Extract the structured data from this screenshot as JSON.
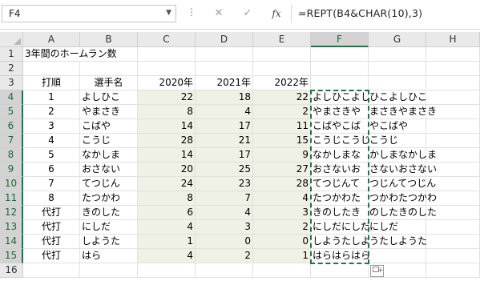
{
  "formula_bar": {
    "name_box": "F4",
    "formula": "=REPT(B4&CHAR(10),3)",
    "cancel_icon": "✕",
    "enter_icon": "✓",
    "fx_label": "fx",
    "more_icon": "⋮"
  },
  "columns": [
    "A",
    "B",
    "C",
    "D",
    "E",
    "F",
    "G",
    "H"
  ],
  "rows": [
    "1",
    "2",
    "3",
    "4",
    "5",
    "6",
    "7",
    "8",
    "9",
    "10",
    "11",
    "12",
    "13",
    "14",
    "15",
    "16"
  ],
  "title": "3年間のホームラン数",
  "headers": {
    "order": "打順",
    "player": "選手名",
    "y2020": "2020年",
    "y2021": "2021年",
    "y2022": "2022年"
  },
  "table": [
    {
      "order": "1",
      "player": "よしひこ",
      "y2020": "22",
      "y2021": "18",
      "y2022": "22",
      "f_text": "よしひこよし",
      "over_text": "ひこよしひこ"
    },
    {
      "order": "2",
      "player": "やまさき",
      "y2020": "8",
      "y2021": "4",
      "y2022": "2",
      "f_text": "やまさきや",
      "over_text": "まさきやまさき"
    },
    {
      "order": "3",
      "player": "こばや",
      "y2020": "14",
      "y2021": "17",
      "y2022": "11",
      "f_text": "こばやこば",
      "over_text": "やこばや"
    },
    {
      "order": "4",
      "player": "こうじ",
      "y2020": "28",
      "y2021": "21",
      "y2022": "15",
      "f_text": "こうじこうじ",
      "over_text": "こうじ"
    },
    {
      "order": "5",
      "player": "なかしま",
      "y2020": "14",
      "y2021": "17",
      "y2022": "9",
      "f_text": "なかしまな",
      "over_text": "かしまなかしま"
    },
    {
      "order": "6",
      "player": "おさない",
      "y2020": "20",
      "y2021": "25",
      "y2022": "27",
      "f_text": "おさないお",
      "over_text": "さないおさない"
    },
    {
      "order": "7",
      "player": "てつじん",
      "y2020": "24",
      "y2021": "23",
      "y2022": "28",
      "f_text": "てつじんて",
      "over_text": "つじんてつじん"
    },
    {
      "order": "8",
      "player": "たつかわ",
      "y2020": "8",
      "y2021": "7",
      "y2022": "4",
      "f_text": "たつかわた",
      "over_text": "つかわたつかわ"
    },
    {
      "order": "代打",
      "player": "きのした",
      "y2020": "6",
      "y2021": "4",
      "y2022": "3",
      "f_text": "きのしたき",
      "over_text": "のしたきのした"
    },
    {
      "order": "代打",
      "player": "にしだ",
      "y2020": "4",
      "y2021": "3",
      "y2022": "2",
      "f_text": "にしだにしだ",
      "over_text": "にしだ"
    },
    {
      "order": "代打",
      "player": "しようた",
      "y2020": "1",
      "y2021": "0",
      "y2022": "0",
      "f_text": "しようたしよ",
      "over_text": "うたしようた"
    },
    {
      "order": "代打",
      "player": "はら",
      "y2020": "4",
      "y2021": "2",
      "y2022": "1",
      "f_text": "はらはらはら",
      "over_text": ""
    }
  ],
  "colors": {
    "accent": "#217346",
    "highlight": "#eef1e3"
  }
}
